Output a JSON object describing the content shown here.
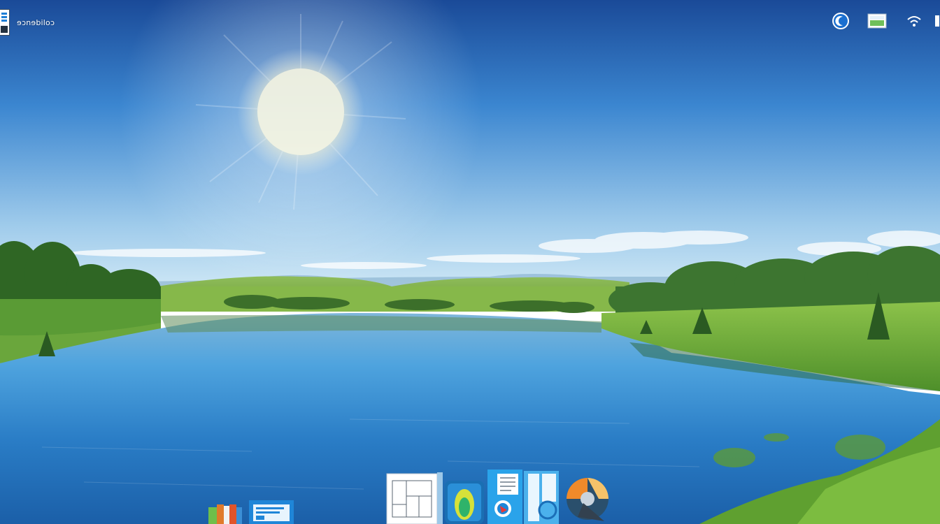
{
  "desktop": {
    "app_label": "ɘɔnɘbiloɔ",
    "wallpaper": "lake-meadow-sun-landscape"
  },
  "tray": {
    "items": [
      {
        "icon": "night-mode-icon"
      },
      {
        "icon": "screen-preview-icon"
      },
      {
        "icon": "wifi-icon"
      }
    ]
  },
  "dock": {
    "items": [
      {
        "icon": "color-bars-app-icon"
      },
      {
        "icon": "text-editor-app-icon"
      },
      {
        "icon": "floor-plan-app-icon"
      },
      {
        "icon": "map-viewer-app-icon"
      },
      {
        "icon": "document-viewer-app-icon"
      },
      {
        "icon": "file-browser-app-icon"
      },
      {
        "icon": "browser-globe-app-icon"
      }
    ]
  },
  "colors": {
    "sky_top": "#1d4f9c",
    "sky_horizon": "#bfe0f2",
    "water": "#2f86cf",
    "grass": "#6fae3a"
  }
}
